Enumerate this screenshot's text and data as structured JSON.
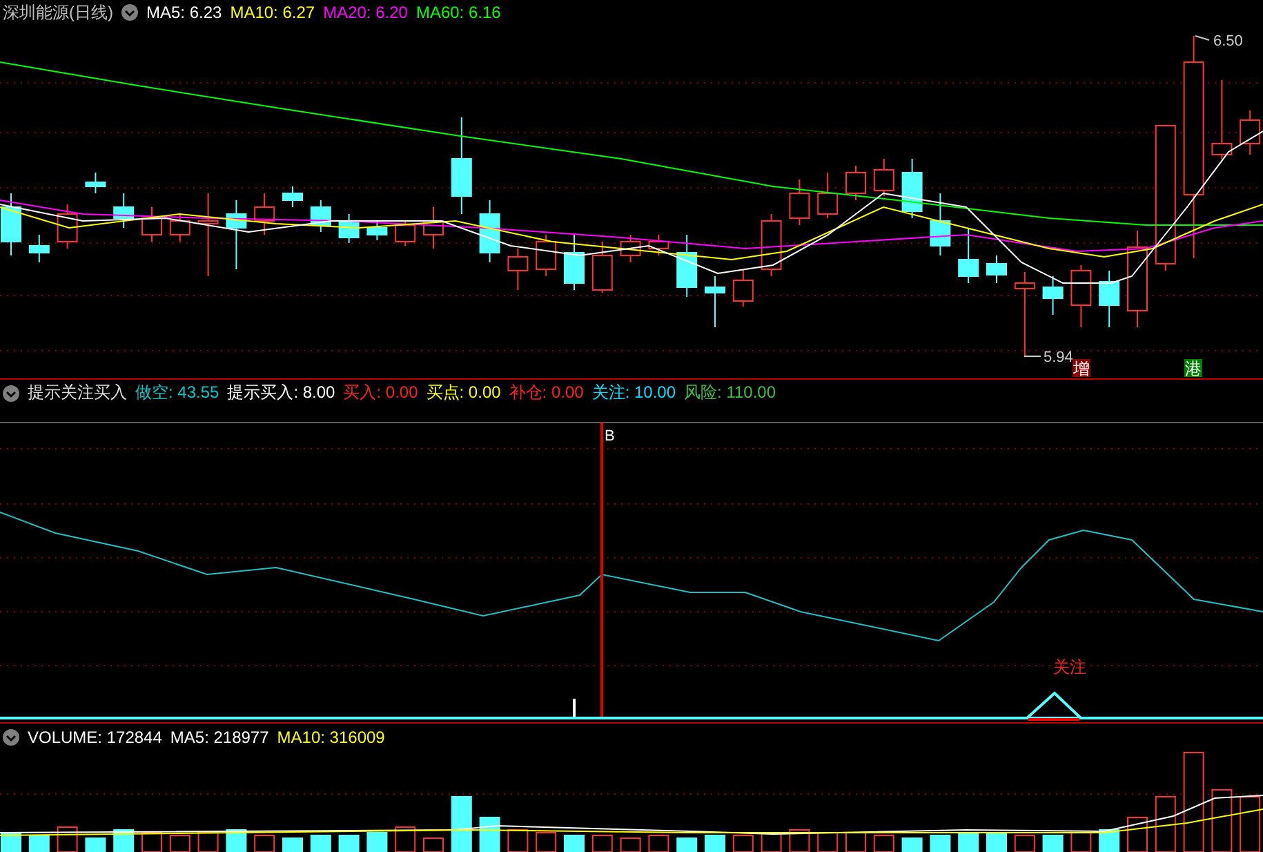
{
  "price_panel": {
    "title": "深圳能源(日线)",
    "legend": [
      {
        "label": "MA5: 6.23",
        "color": "#ffffff"
      },
      {
        "label": "MA10: 6.27",
        "color": "#ffff00"
      },
      {
        "label": "MA20: 6.20",
        "color": "#ff00ff"
      },
      {
        "label": "MA60: 6.16",
        "color": "#00ff00"
      }
    ],
    "high_label": "6.50",
    "low_label": "5.94",
    "markers": [
      {
        "label": "增",
        "color": "#8b0000"
      },
      {
        "label": "港",
        "color": "#008000"
      }
    ]
  },
  "indicator_panel": {
    "title": "提示关注买入",
    "legend": [
      {
        "label": "做空: 43.55",
        "color": "#00c8c8"
      },
      {
        "label": "提示买入: 8.00",
        "color": "#ffffff"
      },
      {
        "label": "买入: 0.00",
        "color": "#ff2020"
      },
      {
        "label": "买点: 0.00",
        "color": "#ffff00"
      },
      {
        "label": "补仓: 0.00",
        "color": "#ff2020"
      },
      {
        "label": "关注: 10.00",
        "color": "#00e0ff"
      },
      {
        "label": "风险: 110.00",
        "color": "#40c040"
      }
    ],
    "signal_label": "B",
    "alert_label": "关注"
  },
  "volume_panel": {
    "legend": [
      {
        "label": "VOLUME: 172844",
        "color": "#ffffff"
      },
      {
        "label": "MA5: 218977",
        "color": "#ffffff"
      },
      {
        "label": "MA10: 316009",
        "color": "#ffff00"
      }
    ]
  }
}
